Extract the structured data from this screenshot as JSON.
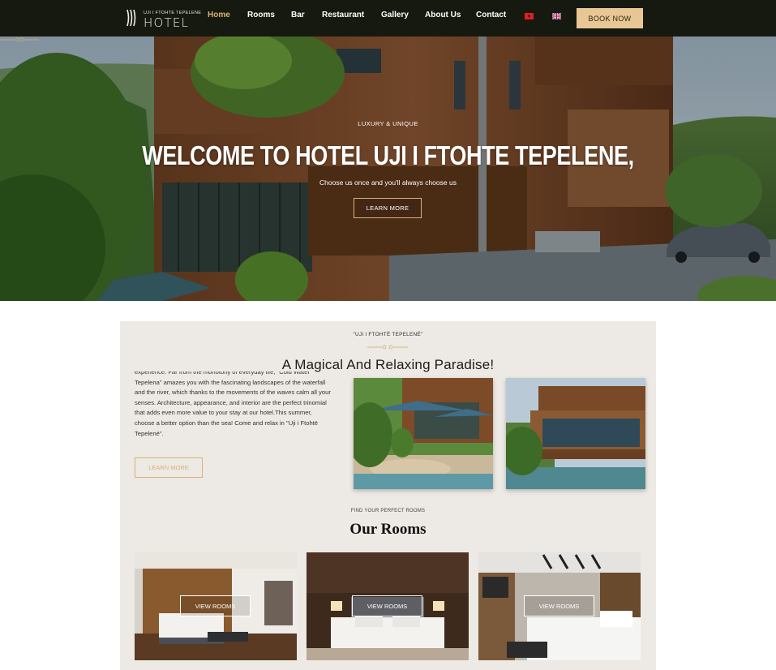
{
  "nav": {
    "logo_subtitle": "UJI I FTOHTE TEPELENE",
    "logo_word": "HOTEL",
    "links": [
      "Home",
      "Rooms",
      "Bar",
      "Restaurant",
      "Gallery",
      "About Us",
      "Contact"
    ],
    "active": "Home",
    "languages": [
      "albanian-flag-icon",
      "uk-flag-icon"
    ],
    "book_label": "BOOK NOW",
    "accent": "#d9b27a",
    "book_bg": "#e8c795",
    "bar_bg": "#16190f"
  },
  "hero": {
    "tagline": "LUXURY & UNIQUE",
    "title": "WELCOME TO HOTEL UJI I FTOHTE TEPELENE,",
    "subtitle": "Choose us once and you'll always choose us",
    "button": "LEARN MORE"
  },
  "about": {
    "kicker": "\"UJI I FTOHTË TEPELENË\"",
    "title": "A Magical And Relaxing Paradise!",
    "text": "experience. Far from the monotony of everyday life, \"Cold Water Tepelena\" amazes you with the fascinating landscapes of the waterfall and the river, which thanks to the movements of the waves calm all your senses. Architecture, appearance, and interior are the perfect trinomial that adds even more value to your stay at our hotel.This summer, choose a better option than the sea! Come and relax in \"Uji i Ftohtë Tepelenë\".",
    "button": "LEARN MORE"
  },
  "rooms": {
    "kicker": "FIND YOUR PERFECT ROOMS",
    "title": "Our Rooms",
    "items": [
      {
        "button": "VIEW ROOMS"
      },
      {
        "button": "VIEW ROOMS"
      },
      {
        "button": "VIEW ROOMS"
      }
    ]
  }
}
